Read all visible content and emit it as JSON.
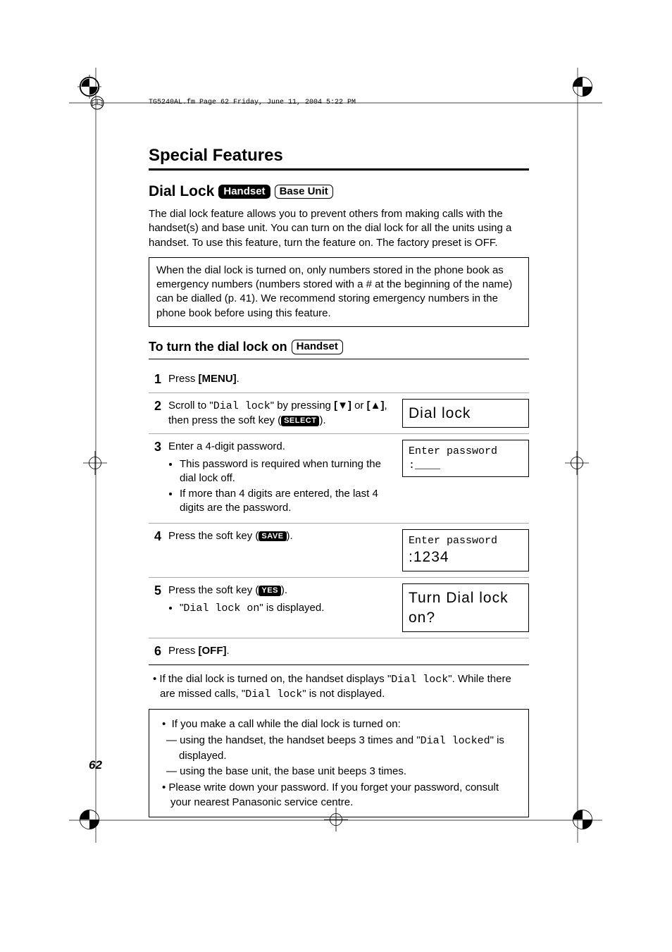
{
  "headerLine": "TG5240AL.fm  Page 62  Friday, June 11, 2004  5:22 PM",
  "sectionTitle": "Special Features",
  "feature": {
    "title": "Dial Lock",
    "tag1": "Handset",
    "tag2": "Base Unit"
  },
  "intro": "The dial lock feature allows you to prevent others from making calls with the handset(s) and base unit. You can turn on the dial lock for all the units using a handset. To use this feature, turn the feature on. The factory preset is OFF.",
  "infoBox": "When the dial lock is turned on, only numbers stored in the phone book as emergency numbers (numbers stored with a # at the beginning of the name) can be dialled (p. 41). We recommend storing emergency numbers in the phone book before using this feature.",
  "sub": {
    "heading": "To turn the dial lock on",
    "tag": "Handset"
  },
  "steps": [
    {
      "num": "1",
      "pre": "Press ",
      "bold": "[MENU]",
      "post": "."
    },
    {
      "num": "2",
      "pre": "Scroll to \"",
      "mono": "Dial lock",
      "mid1": "\" by pressing ",
      "bold1": "[▼]",
      "mid2": " or ",
      "bold2": "[▲]",
      "mid3": ", then press the soft key (",
      "soft": "SELECT",
      "post": ").",
      "lcdBig": "Dial lock"
    },
    {
      "num": "3",
      "text": "Enter a 4-digit password.",
      "bullets": [
        "This password is required when turning the dial lock off.",
        "If more than 4 digits are entered, the last 4 digits are the password."
      ],
      "lcdLine1": "Enter password",
      "lcdLine2": ":____"
    },
    {
      "num": "4",
      "pre": "Press the soft key (",
      "soft": "SAVE",
      "post": ").",
      "lcdLine1": "Enter password",
      "lcdBig2": ":1234"
    },
    {
      "num": "5",
      "pre": "Press the soft key (",
      "soft": "YES",
      "post": ").",
      "subPre": "\"",
      "subMono": "Dial lock on",
      "subPost": "\" is displayed.",
      "lcdBigA": "Turn Dial lock",
      "lcdBigB": "on?"
    },
    {
      "num": "6",
      "pre": "Press ",
      "bold": "[OFF]",
      "post": "."
    }
  ],
  "afterNote": {
    "pre": "• If the dial lock is turned on, the handset displays \"",
    "mono1": "Dial lock",
    "mid": "\". While there are missed calls, \"",
    "mono2": "Dial lock",
    "post": "\" is not displayed."
  },
  "tips": {
    "line1": "If you make a call while the dial lock is turned on:",
    "dash1pre": "— using the handset, the handset beeps 3 times and \"",
    "dash1mono": "Dial locked",
    "dash1post": "\" is displayed.",
    "dash2": "— using the base unit, the base unit beeps 3 times.",
    "line2": "Please write down your password. If you forget your password, consult your nearest Panasonic service centre."
  },
  "pageNum": "62"
}
